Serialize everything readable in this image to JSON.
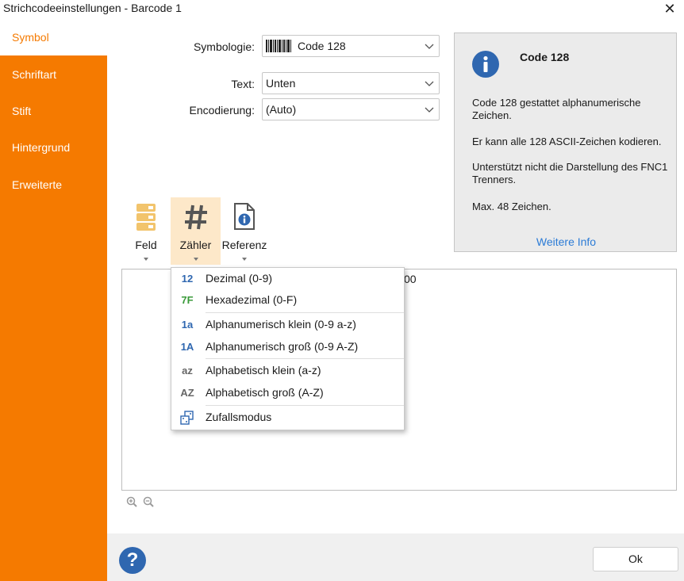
{
  "window": {
    "title": "Strichcodeeinstellungen - Barcode 1",
    "close_glyph": "✕"
  },
  "sidebar": {
    "items": [
      {
        "label": "Symbol",
        "active": true
      },
      {
        "label": "Schriftart",
        "active": false
      },
      {
        "label": "Stift",
        "active": false
      },
      {
        "label": "Hintergrund",
        "active": false
      },
      {
        "label": "Erweiterte",
        "active": false
      }
    ]
  },
  "form": {
    "symbology": {
      "label": "Symbologie:",
      "value": "Code 128"
    },
    "text": {
      "label": "Text:",
      "value": "Unten"
    },
    "encoding": {
      "label": "Encodierung:",
      "value": "(Auto)"
    }
  },
  "info": {
    "title": "Code 128",
    "p1": "Code 128 gestattet alphanumerische Zeichen.",
    "p2": "Er kann alle 128 ASCII-Zeichen kodieren.",
    "p3": "Unterstützt nicht die Darstellung des FNC1 Trenners.",
    "p4": "Max. 48 Zeichen.",
    "more_link": "Weitere Info"
  },
  "toolbar": {
    "field_label": "Feld",
    "counter_label": "Zähler",
    "reference_label": "Referenz"
  },
  "editor": {
    "visible_text": "00"
  },
  "counter_menu": {
    "items": [
      {
        "icon": "12",
        "label": "Dezimal (0-9)",
        "icon_color": "#2f67b0"
      },
      {
        "icon": "7F",
        "label": "Hexadezimal (0-F)",
        "icon_color": "#3a9a3a"
      },
      {
        "icon": "1a",
        "label": "Alphanumerisch klein (0-9 a-z)",
        "icon_color": "#2f67b0"
      },
      {
        "icon": "1A",
        "label": "Alphanumerisch groß (0-9 A-Z)",
        "icon_color": "#2f67b0"
      },
      {
        "icon": "az",
        "label": "Alphabetisch klein (a-z)",
        "icon_color": "#666666"
      },
      {
        "icon": "AZ",
        "label": "Alphabetisch groß (A-Z)",
        "icon_color": "#666666"
      },
      {
        "icon": "random-icon",
        "label": "Zufallsmodus",
        "icon_color": "#2f67b0"
      }
    ]
  },
  "footer": {
    "help_glyph": "?",
    "ok_label": "Ok"
  },
  "colors": {
    "accent": "#f57a00",
    "link": "#2b7bd6",
    "info_blue": "#2f67b0",
    "active_tool": "#fde8c9"
  }
}
